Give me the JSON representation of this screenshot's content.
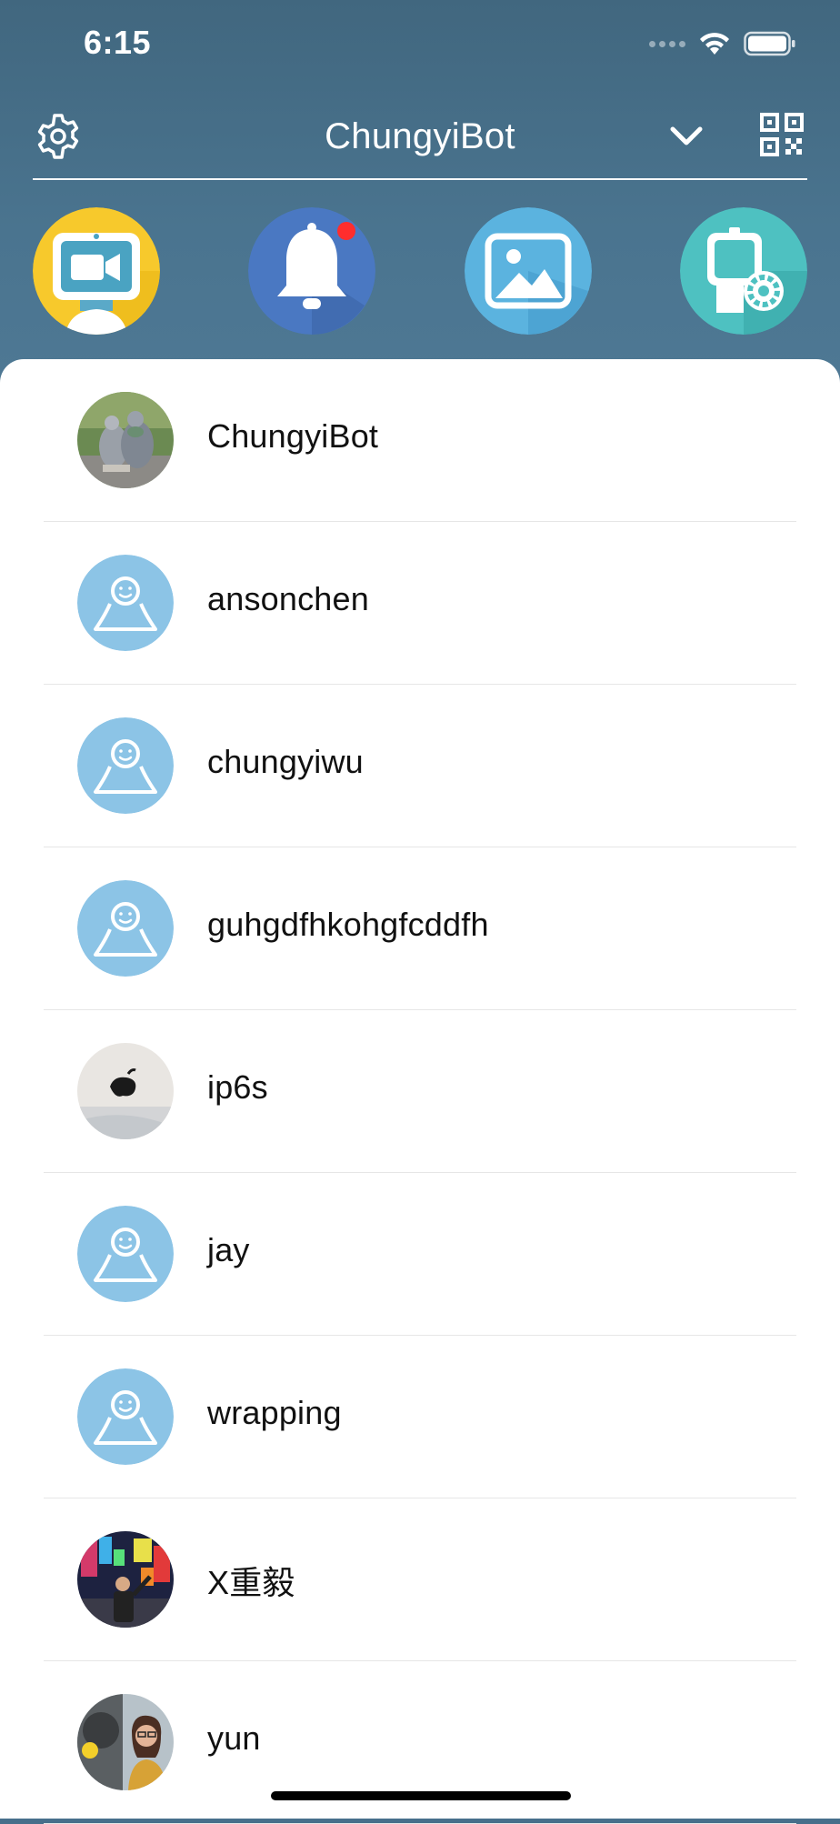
{
  "status_bar": {
    "time": "6:15"
  },
  "header": {
    "title": "ChungyiBot"
  },
  "shortcuts": [
    {
      "icon": "video-robot-icon"
    },
    {
      "icon": "bell-icon",
      "has_badge": true
    },
    {
      "icon": "gallery-icon"
    },
    {
      "icon": "device-settings-icon"
    }
  ],
  "contacts": [
    {
      "name": "ChungyiBot",
      "avatar": "photo-pigeons"
    },
    {
      "name": "ansonchen",
      "avatar": "default-user"
    },
    {
      "name": "chungyiwu",
      "avatar": "default-user"
    },
    {
      "name": "guhgdfhkohgfcddfh",
      "avatar": "default-user"
    },
    {
      "name": "ip6s",
      "avatar": "photo-device"
    },
    {
      "name": "jay",
      "avatar": "default-user"
    },
    {
      "name": "wrapping",
      "avatar": "default-user"
    },
    {
      "name": "X重毅",
      "avatar": "photo-city"
    },
    {
      "name": "yun",
      "avatar": "photo-person"
    }
  ],
  "colors": {
    "header_bg": "#476f8b",
    "default_avatar": "#8cc4e6",
    "badge": "#ff2d2d"
  }
}
